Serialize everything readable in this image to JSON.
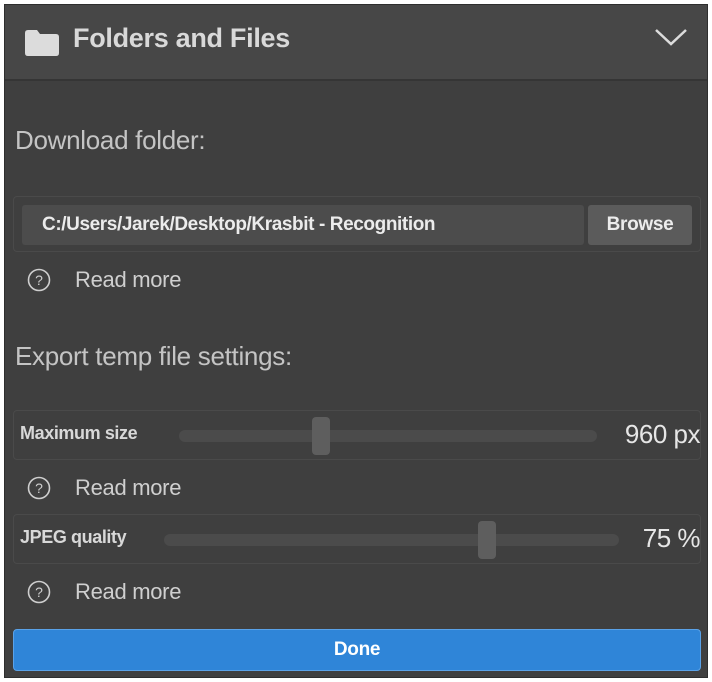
{
  "header": {
    "title": "Folders and Files",
    "folder_icon": "folder-icon",
    "collapse_icon": "chevron-down-icon"
  },
  "download": {
    "heading": "Download folder:",
    "path_value": "C:/Users/Jarek/Desktop/Krasbit - Recognition",
    "browse_label": "Browse",
    "read_more": "Read more"
  },
  "export": {
    "heading": "Export temp file settings:",
    "max_size": {
      "label": "Maximum size",
      "value_text": "960 px",
      "fraction": 0.34
    },
    "max_size_read_more": "Read more",
    "jpeg_quality": {
      "label": "JPEG quality",
      "value_text": "75 %",
      "fraction": 0.71
    },
    "jpeg_read_more": "Read more"
  },
  "footer": {
    "done_label": "Done"
  },
  "colors": {
    "panel_bg": "#3f3f3f",
    "header_bg": "#474747",
    "accent": "#2f85d8"
  }
}
